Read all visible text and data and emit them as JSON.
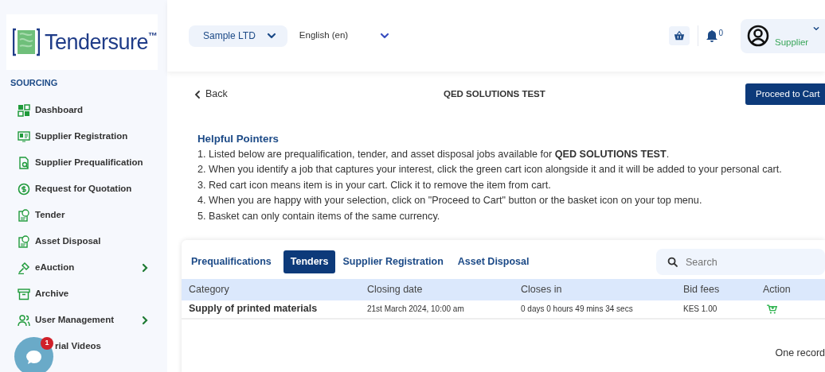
{
  "logo": {
    "text": "Tendersure",
    "mark": "™"
  },
  "sidebar": {
    "section": "SOURCING",
    "items": [
      {
        "label": "Dashboard",
        "expandable": false
      },
      {
        "label": "Supplier Registration",
        "expandable": false
      },
      {
        "label": "Supplier Prequalification",
        "expandable": false
      },
      {
        "label": "Request for Quotation",
        "expandable": false
      },
      {
        "label": "Tender",
        "expandable": false
      },
      {
        "label": "Asset Disposal",
        "expandable": false
      },
      {
        "label": "eAuction",
        "expandable": true
      },
      {
        "label": "Archive",
        "expandable": false
      },
      {
        "label": "User Management",
        "expandable": true
      },
      {
        "label": "rial Videos",
        "expandable": false
      }
    ]
  },
  "chat": {
    "badge": "1"
  },
  "topbar": {
    "company": "Sample LTD",
    "language": "English (en)",
    "notifications": "0",
    "role": "Supplier"
  },
  "page": {
    "back": "Back",
    "title": "QED SOLUTIONS TEST",
    "action": "Proceed to Cart"
  },
  "pointers": {
    "heading": "Helpful Pointers",
    "lines": [
      "1. Listed below are prequalification, tender, and asset disposal jobs available for **QED SOLUTIONS TEST**.",
      "2. When you identify a job that captures your interest, click the green cart icon alongside it and it will be added to your personal cart.",
      "3. Red cart icon means item is in your cart. Click it to remove the item from cart.",
      "4. When you are happy with your selection, click on \"Proceed to Cart\" button or the basket icon on your top menu.",
      "5. Basket can only contain items of the same currency."
    ]
  },
  "tabs": [
    {
      "label": "Prequalifications",
      "selected": false
    },
    {
      "label": "Tenders",
      "selected": true
    },
    {
      "label": "Supplier Registration",
      "selected": false
    },
    {
      "label": "Asset Disposal",
      "selected": false
    }
  ],
  "search": {
    "placeholder": "Search"
  },
  "table": {
    "columns": [
      "Category",
      "Closing date",
      "Closes in",
      "Bid fees",
      "Action"
    ],
    "rows": [
      {
        "category": "Supply of printed materials",
        "closing_date": "21st March 2024, 10:00 am",
        "closes_in": "0 days 0 hours 49 mins 34 secs",
        "bid_fees": "KES 1.00",
        "in_cart": false
      }
    ]
  },
  "footer": "One record"
}
